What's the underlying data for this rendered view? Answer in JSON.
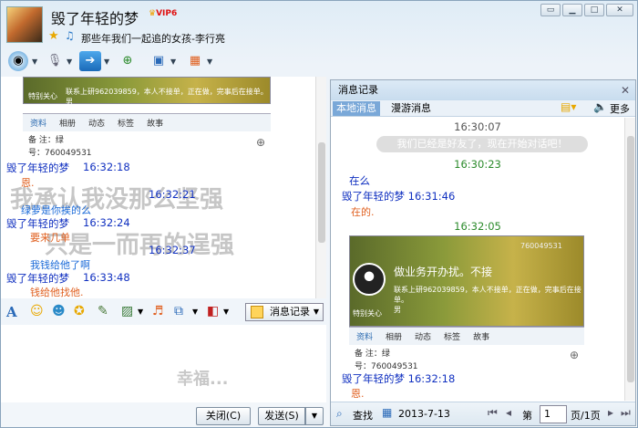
{
  "header": {
    "nickname": "毁了年轻的梦",
    "vip": "VIP6",
    "signature": "那些年我们一起追的女孩-李行亮"
  },
  "chat": {
    "card_contact_line": "联系上研962039859，本人不接单，正在做，完事后在接单。",
    "card_contact_line2": "男",
    "card_special": "特别关心",
    "card_tabs": [
      "资料",
      "相册",
      "动态",
      "标签",
      "故事"
    ],
    "card_info_label": "备",
    "card_info_value": "注：绿",
    "card_number_label": "号",
    "card_number_value": "号：760049531",
    "messages": [
      {
        "sender": "毁了年轻的梦",
        "time": "16:32:18",
        "text": "恩."
      },
      {
        "time": "16:32:21"
      },
      {
        "text": "绿萝是你挨的么"
      },
      {
        "sender": "毁了年轻的梦",
        "time": "16:32:24",
        "text": "要来几单"
      },
      {
        "time": "16:32:37"
      },
      {
        "text": "我钱给他了啊"
      },
      {
        "sender": "毁了年轻的梦",
        "time": "16:33:48",
        "text": "钱给他找他."
      }
    ],
    "ghost_lines": [
      "我承认我没那么坚强",
      "只是一而再的逞强"
    ]
  },
  "input": {
    "ghost": "幸福...",
    "close_label": "关闭(C)",
    "send_label": "发送(S)"
  },
  "history_button": "消息记录",
  "history": {
    "title": "消息记录",
    "tabs": [
      "本地消息",
      "漫游消息"
    ],
    "more": "更多",
    "top_time": "16:30:07",
    "system_msg": "我们已经是好友了，现在开始对话吧！",
    "time2": "16:30:23",
    "msg1": "在么",
    "sender_time": "毁了年轻的梦  16:31:46",
    "reply1": "在的.",
    "time3": "16:32:05",
    "card_title": "做业务开办扰。不接",
    "card_number": "760049531",
    "card_contact": "联系上研962039859，本人不接单，正在做，完事后在接单。",
    "card_gender": "男",
    "card_special": "特别关心",
    "card_tabs": [
      "资料",
      "相册",
      "动态",
      "标签",
      "故事"
    ],
    "card_info": "注：绿",
    "card_num_line": "号：760049531",
    "sender_time2": "毁了年轻的梦  16:32:18",
    "reply2": "恩.",
    "footer": {
      "find": "查找",
      "date": "2013-7-13",
      "page_prefix": "第",
      "page": "1",
      "page_suffix": "页/1页"
    }
  }
}
